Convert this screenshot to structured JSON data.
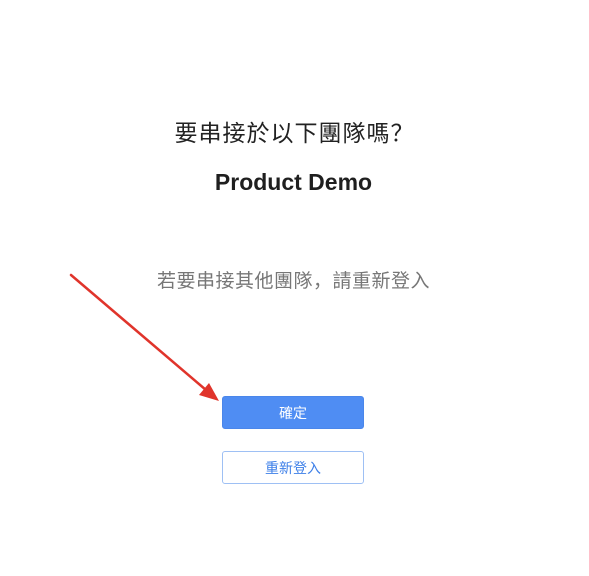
{
  "dialog": {
    "question": "要串接於以下團隊嗎？",
    "team_name": "Product Demo",
    "hint": "若要串接其他團隊，請重新登入",
    "confirm_label": "確定",
    "relogin_label": "重新登入"
  },
  "annotation": {
    "arrow_color": "#e0342b"
  },
  "colors": {
    "primary": "#4f8df3",
    "secondary_text": "#777777"
  }
}
